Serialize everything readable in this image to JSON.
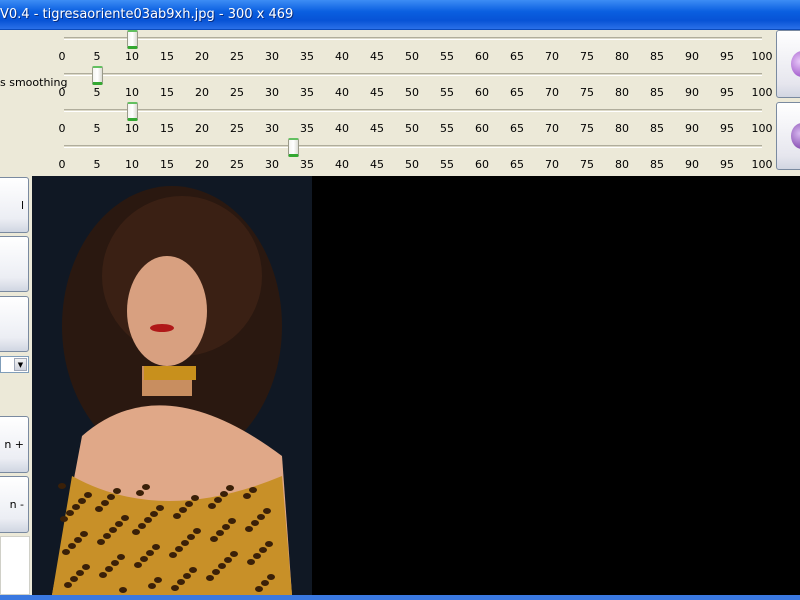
{
  "window": {
    "title": "V0.4 - tigresaoriente03ab9xh.jpg - 300 x 469"
  },
  "sliders": [
    {
      "label": "",
      "value": 10,
      "min": 0,
      "max": 100
    },
    {
      "label": "s smoothing",
      "value": 5,
      "min": 0,
      "max": 100
    },
    {
      "label": "",
      "value": 10,
      "min": 0,
      "max": 100
    },
    {
      "label": "",
      "value": 33,
      "min": 0,
      "max": 100
    }
  ],
  "ticks": [
    "0",
    "5",
    "10",
    "15",
    "20",
    "25",
    "30",
    "35",
    "40",
    "45",
    "50",
    "55",
    "60",
    "65",
    "70",
    "75",
    "80",
    "85",
    "90",
    "95",
    "100"
  ],
  "left_buttons": [
    {
      "label": "l"
    },
    {
      "label": ""
    },
    {
      "label": ""
    },
    {
      "label": "n +"
    },
    {
      "label": "n -"
    }
  ],
  "dropdown": {
    "value": ""
  },
  "right_buttons": [
    {
      "icon": "purple-orb-icon"
    },
    {
      "icon": "purple-orb-save-icon"
    }
  ],
  "colors": {
    "thumb_accent": "#34a832",
    "titlebar": "#0a5fe0"
  }
}
